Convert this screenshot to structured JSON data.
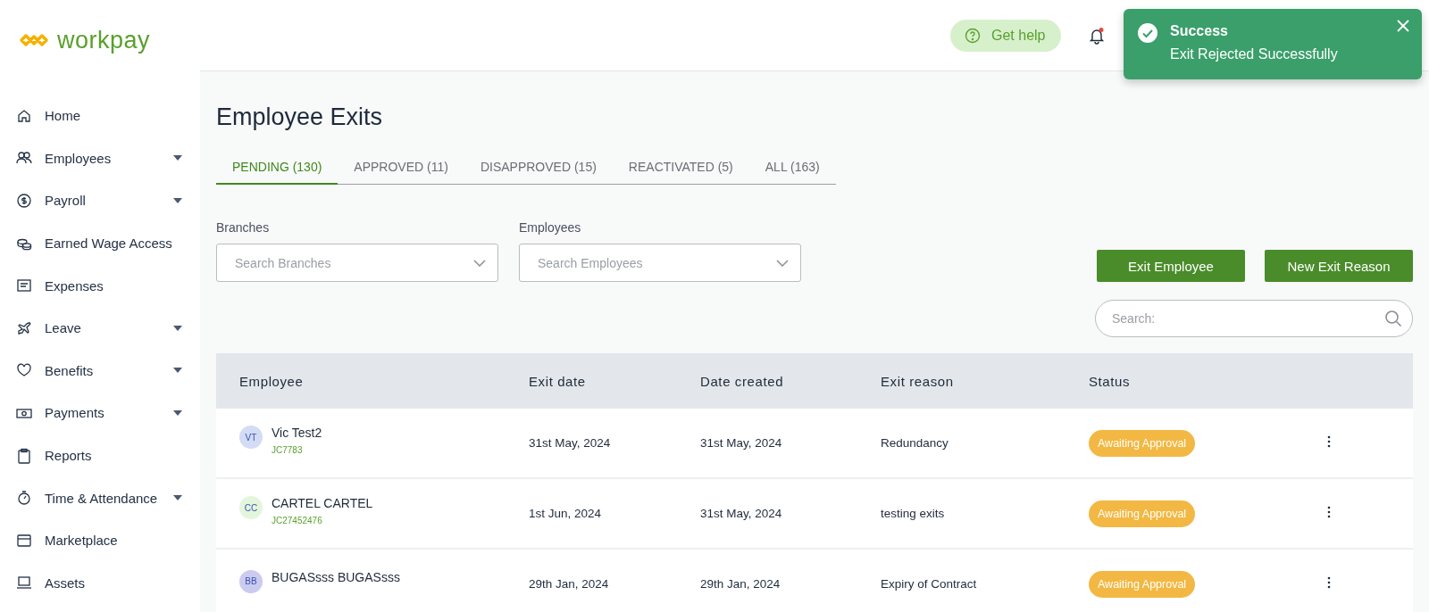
{
  "brand": {
    "name": "workpay"
  },
  "sidebar": {
    "items": [
      {
        "label": "Home",
        "expandable": false
      },
      {
        "label": "Employees",
        "expandable": true
      },
      {
        "label": "Payroll",
        "expandable": true
      },
      {
        "label": "Earned Wage Access",
        "expandable": false
      },
      {
        "label": "Expenses",
        "expandable": false
      },
      {
        "label": "Leave",
        "expandable": true
      },
      {
        "label": "Benefits",
        "expandable": true
      },
      {
        "label": "Payments",
        "expandable": true
      },
      {
        "label": "Reports",
        "expandable": false
      },
      {
        "label": "Time & Attendance",
        "expandable": true
      },
      {
        "label": "Marketplace",
        "expandable": false
      },
      {
        "label": "Assets",
        "expandable": false
      }
    ]
  },
  "header": {
    "help_button": "Get help",
    "notifications_unread": true
  },
  "toast": {
    "title": "Success",
    "message": "Exit Rejected Successfully"
  },
  "page": {
    "title": "Employee Exits"
  },
  "tabs": [
    {
      "label": "PENDING (130)",
      "selected": true
    },
    {
      "label": "APPROVED (11)",
      "selected": false
    },
    {
      "label": "DISAPPROVED (15)",
      "selected": false
    },
    {
      "label": "REACTIVATED (5)",
      "selected": false
    },
    {
      "label": "ALL (163)",
      "selected": false
    }
  ],
  "filters": [
    {
      "label": "Branches",
      "placeholder": "Search Branches"
    },
    {
      "label": "Employees",
      "placeholder": "Search Employees"
    }
  ],
  "actions": [
    "Exit Employee",
    "New Exit Reason"
  ],
  "search": {
    "placeholder": "Search:"
  },
  "table": {
    "columns": [
      "Employee",
      "Exit date",
      "Date created",
      "Exit reason",
      "Status"
    ],
    "rows": [
      {
        "initials": "VT",
        "color": "#d3dcf5",
        "name": "Vic Test2",
        "code": "JC7783",
        "exit_date": "31st May, 2024",
        "date_created": "31st May, 2024",
        "reason": "Redundancy",
        "status": "Awaiting Approval"
      },
      {
        "initials": "CC",
        "color": "#e3f6dc",
        "name": "CARTEL CARTEL",
        "code": "JC27452476",
        "exit_date": "1st Jun, 2024",
        "date_created": "31st May, 2024",
        "reason": "testing exits",
        "status": "Awaiting Approval"
      },
      {
        "initials": "BB",
        "color": "#cbcbf0",
        "name": "BUGASsss BUGASsss",
        "exit_date": "29th Jan, 2024",
        "date_created": "29th Jan, 2024",
        "reason": "Expiry of Contract",
        "status": "Awaiting Approval"
      }
    ]
  }
}
